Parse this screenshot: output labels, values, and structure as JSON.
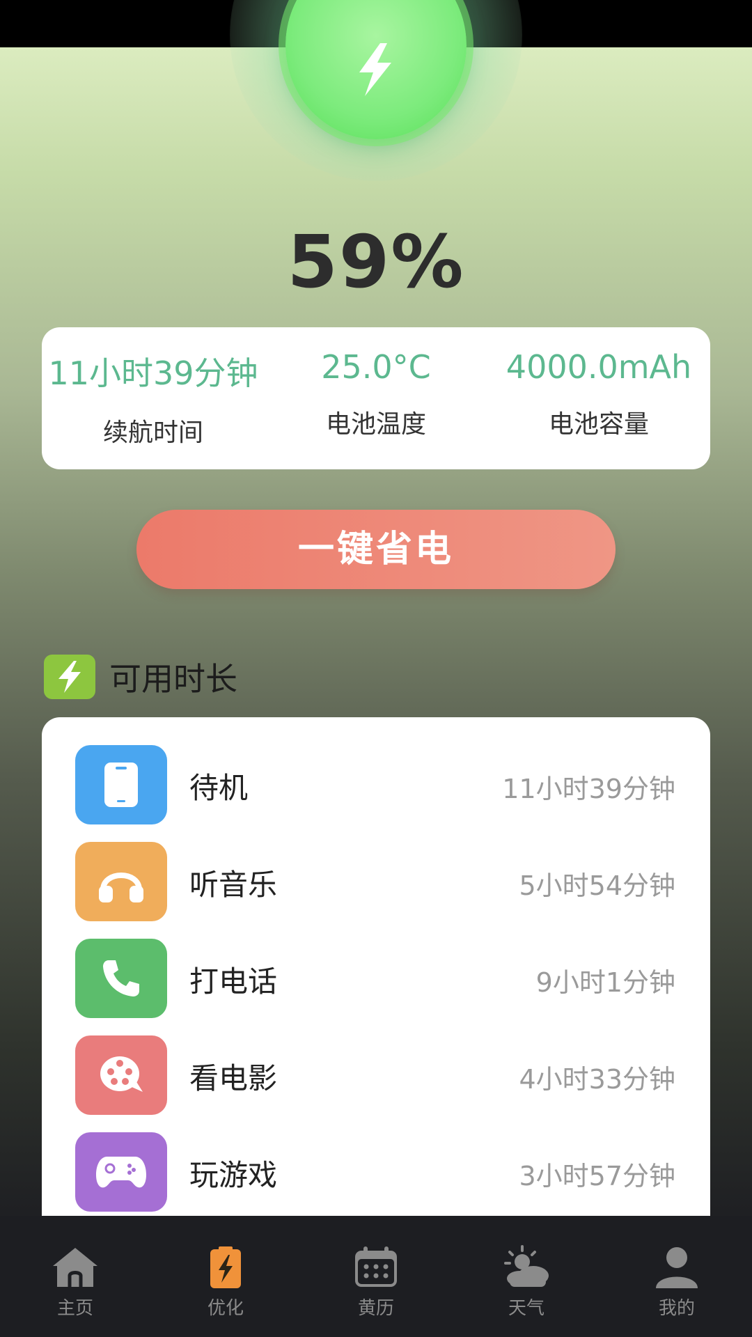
{
  "battery": {
    "percent": "59%",
    "level": 0.59
  },
  "stats": [
    {
      "value": "11小时39分钟",
      "label": "续航时间"
    },
    {
      "value": "25.0°C",
      "label": "电池温度"
    },
    {
      "value": "4000.0mAh",
      "label": "电池容量"
    }
  ],
  "actions": {
    "save_button": "一键省电"
  },
  "section": {
    "title": "可用时长"
  },
  "usage": [
    {
      "label": "待机",
      "time": "11小时39分钟",
      "color": "#4aa6f0",
      "icon": "phone-icon"
    },
    {
      "label": "听音乐",
      "time": "5小时54分钟",
      "color": "#f0ad5b",
      "icon": "headphones-icon"
    },
    {
      "label": "打电话",
      "time": "9小时1分钟",
      "color": "#5cbd6c",
      "icon": "call-icon"
    },
    {
      "label": "看电影",
      "time": "4小时33分钟",
      "color": "#e97c7c",
      "icon": "film-icon"
    },
    {
      "label": "玩游戏",
      "time": "3小时57分钟",
      "color": "#a56fd4",
      "icon": "gamepad-icon"
    }
  ],
  "tabs": [
    {
      "label": "主页",
      "icon": "home-icon",
      "active": false
    },
    {
      "label": "优化",
      "icon": "battery-charge-icon",
      "active": true
    },
    {
      "label": "黄历",
      "icon": "calendar-icon",
      "active": false
    },
    {
      "label": "天气",
      "icon": "weather-icon",
      "active": false
    },
    {
      "label": "我的",
      "icon": "profile-icon",
      "active": false
    }
  ],
  "colors": {
    "accent_green": "#5cb88f",
    "button": "#ec7a6a",
    "section_icon": "#8dc63f",
    "active_tab_icon": "#f0923a"
  }
}
